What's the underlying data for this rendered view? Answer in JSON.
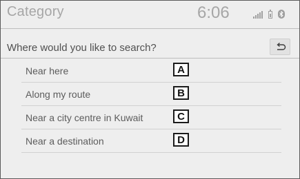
{
  "header": {
    "title": "Category",
    "clock": "6:06",
    "status_icons": [
      "signal-strength-icon",
      "battery-icon",
      "bluetooth-icon"
    ]
  },
  "prompt": {
    "text": "Where would you like to search?",
    "back_icon": "return-arrow-icon"
  },
  "options": [
    {
      "label": "Near here",
      "marker": "A"
    },
    {
      "label": "Along my route",
      "marker": "B"
    },
    {
      "label": "Near a city centre in Kuwait",
      "marker": "C"
    },
    {
      "label": "Near a destination",
      "marker": "D"
    }
  ],
  "colors": {
    "background": "#eeeeee",
    "header_text": "#a6a6a6",
    "option_text": "#5c5c5c",
    "marker_border": "#1a1a1a"
  }
}
